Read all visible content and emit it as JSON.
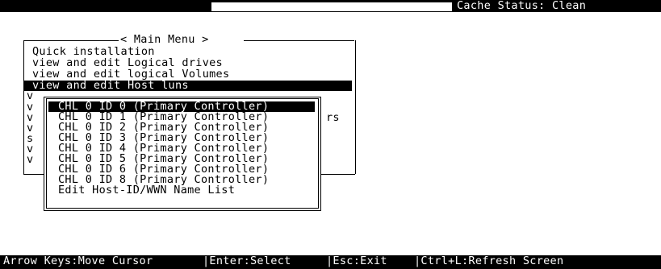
{
  "status_bar": {
    "cache_status": "Cache Status: Clean"
  },
  "main_menu": {
    "title": "< Main Menu >",
    "items": [
      {
        "label": "Quick installation"
      },
      {
        "label": "view and edit Logical drives"
      },
      {
        "label": "view and edit logical Volumes"
      },
      {
        "label": "view and edit Host luns"
      }
    ],
    "selected_index": 3,
    "hidden_item_initials": [
      "v",
      "v",
      "v",
      "v",
      "s",
      "v",
      "v"
    ],
    "partial_text": "rs"
  },
  "host_luns_menu": {
    "items": [
      {
        "label": "CHL 0 ID 0 (Primary Controller)"
      },
      {
        "label": "CHL 0 ID 1 (Primary Controller)"
      },
      {
        "label": "CHL 0 ID 2 (Primary Controller)"
      },
      {
        "label": "CHL 0 ID 3 (Primary Controller)"
      },
      {
        "label": "CHL 0 ID 4 (Primary Controller)"
      },
      {
        "label": "CHL 0 ID 5 (Primary Controller)"
      },
      {
        "label": "CHL 0 ID 6 (Primary Controller)"
      },
      {
        "label": "CHL 0 ID 8 (Primary Controller)"
      },
      {
        "label": "Edit Host-ID/WWN Name List"
      }
    ],
    "selected_index": 0
  },
  "help_bar": {
    "arrow_keys": "Arrow Keys:Move Cursor",
    "enter": "|Enter:Select",
    "esc": "|Esc:Exit",
    "refresh": "|Ctrl+L:Refresh Screen"
  },
  "colors": {
    "background": "#ffffff",
    "foreground": "#000000",
    "highlight_bg": "#000000",
    "highlight_fg": "#ffffff"
  }
}
